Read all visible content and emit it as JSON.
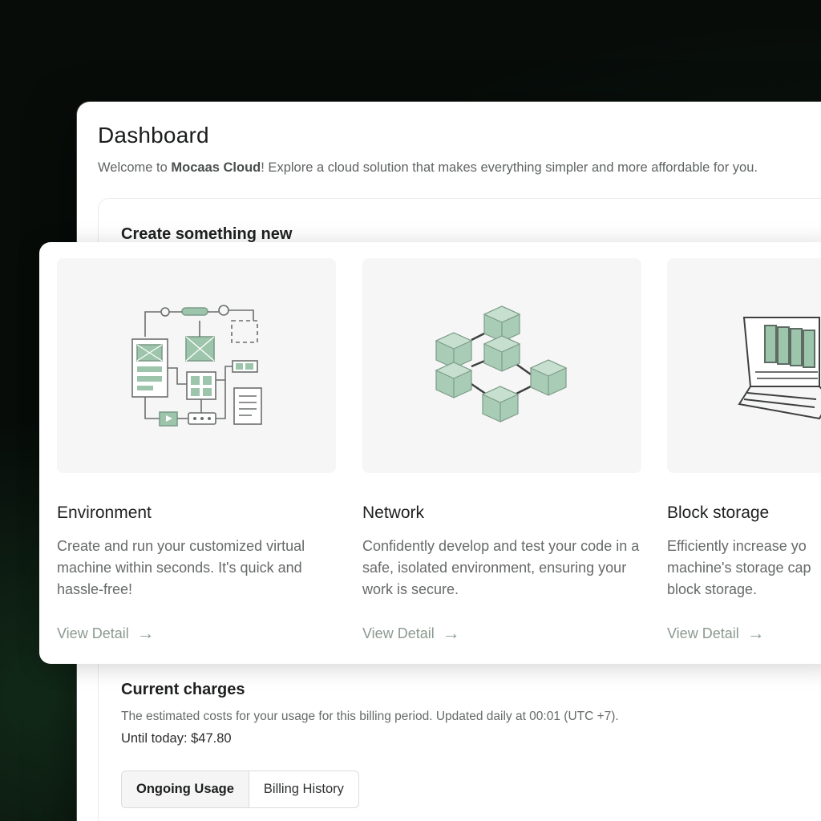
{
  "header": {
    "title": "Dashboard",
    "welcome_prefix": "Welcome to ",
    "brand": "Mocaas Cloud",
    "welcome_suffix": "! Explore a cloud solution that makes everything simpler and more affordable for you."
  },
  "create_section": {
    "title": "Create something new",
    "cards": [
      {
        "title": "Environment",
        "description": "Create and run your customized virtual machine within seconds. It's quick and hassle-free!",
        "link": "View Detail",
        "icon": "workflow-diagram-icon"
      },
      {
        "title": "Network",
        "description": "Confidently develop and test your code in a safe, isolated environment, ensuring your work is secure.",
        "link": "View Detail",
        "icon": "linked-blocks-icon"
      },
      {
        "title": "Block storage",
        "description": "Efficiently increase yo machine's storage cap block storage.",
        "link": "View Detail",
        "icon": "laptop-storage-icon"
      }
    ]
  },
  "charges": {
    "title": "Current charges",
    "description": "The estimated costs for your usage for this billing period. Updated daily at 00:01 (UTC +7).",
    "until_today": "Until today: $47.80",
    "tabs": [
      "Ongoing Usage",
      "Billing History"
    ]
  },
  "colors": {
    "accent_green": "#9cc5ab",
    "link_text": "#8a9a8f",
    "background_dark": "#0b140f"
  }
}
